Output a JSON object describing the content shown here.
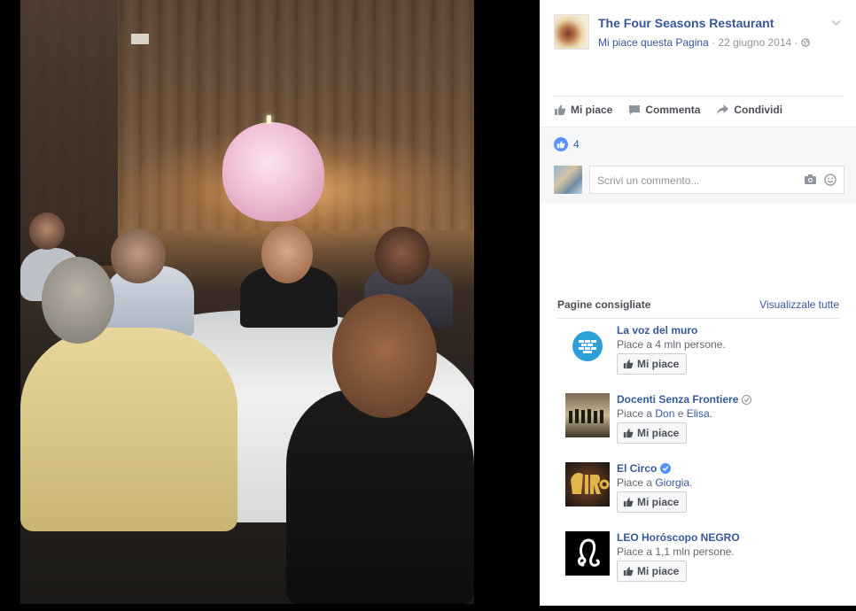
{
  "post": {
    "page_name": "The Four Seasons Restaurant",
    "like_page": "Mi piace questa Pagina",
    "sep1": " · ",
    "date": "22 giugno 2014",
    "sep2": " · ",
    "privacy_icon": "globe-icon"
  },
  "actions": {
    "like": "Mi piace",
    "comment": "Commenta",
    "share": "Condividi"
  },
  "reactions": {
    "count": "4"
  },
  "comment_box": {
    "placeholder": "Scrivi un commento..."
  },
  "suggested": {
    "title": "Pagine consigliate",
    "see_all": "Visualizzale tutte",
    "items": [
      {
        "name": "La voz del muro",
        "desc_prefix": "Piace a 4 mln persone.",
        "button": "Mi piace",
        "verified": "none"
      },
      {
        "name": "Docenti Senza Frontiere",
        "desc_prefix": "Piace a ",
        "friend1": "Don",
        "and": " e ",
        "friend2": "Elisa",
        "desc_suffix": ".",
        "button": "Mi piace",
        "verified": "grey"
      },
      {
        "name": "El Circo",
        "desc_prefix": "Piace a ",
        "friend1": "Giorgia",
        "desc_suffix": ".",
        "button": "Mi piace",
        "verified": "blue"
      },
      {
        "name": "LEO Horóscopo NEGRO",
        "desc_prefix": "Piace a 1,1 mln persone.",
        "button": "Mi piace",
        "verified": "none"
      }
    ]
  },
  "colors": {
    "link": "#365899",
    "like_blue": "#5890ff",
    "muted": "#90949c"
  }
}
